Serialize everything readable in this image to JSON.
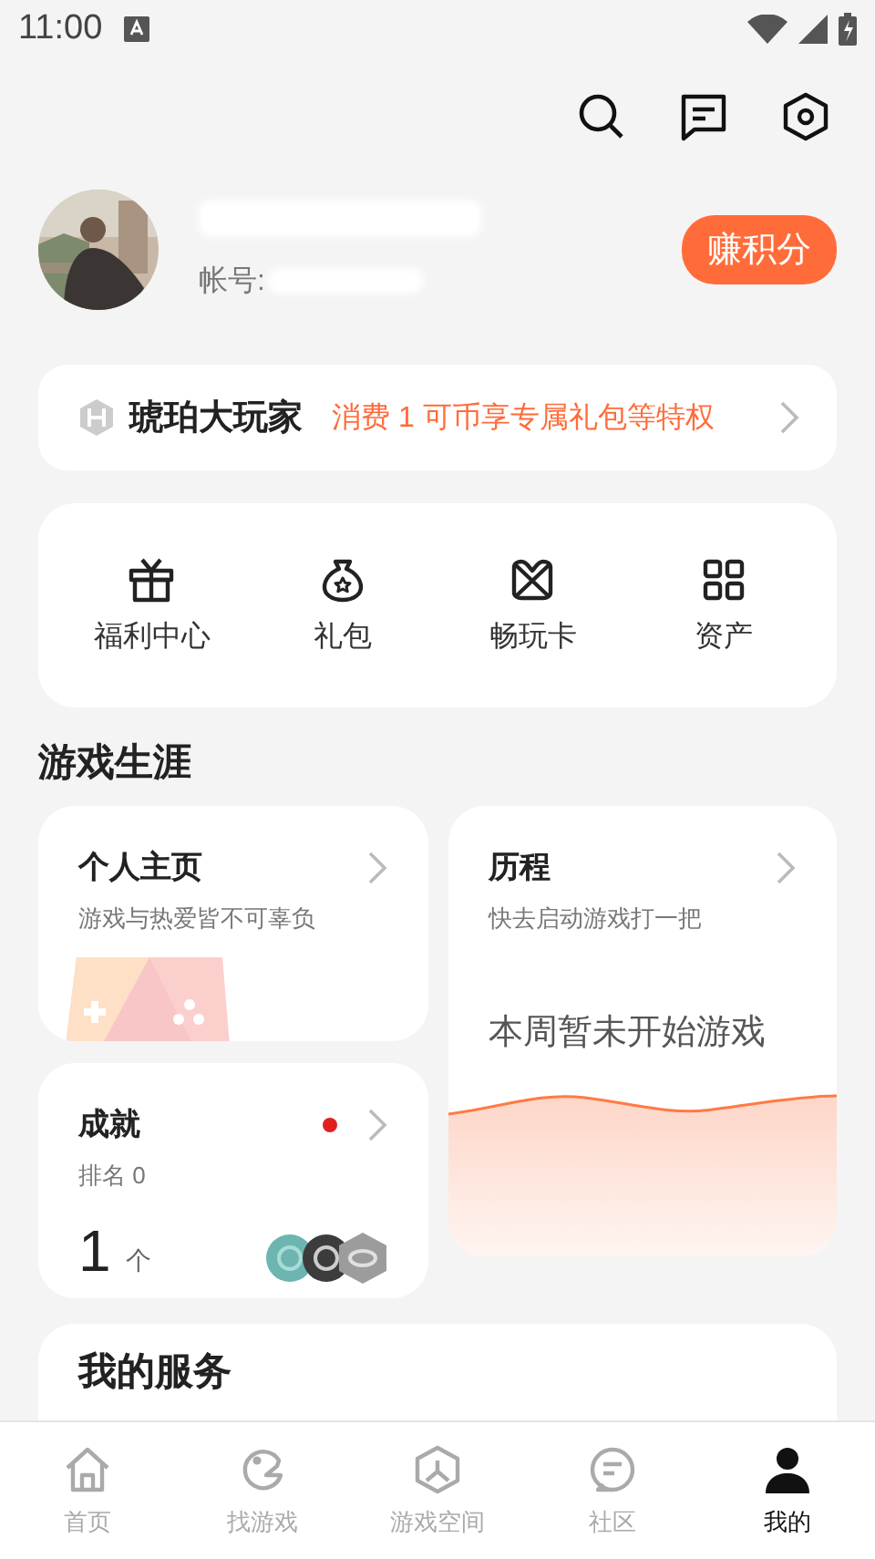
{
  "status_bar": {
    "time": "11:00"
  },
  "profile": {
    "account_label": "帐号:",
    "earn_button": "赚积分"
  },
  "membership": {
    "title": "琥珀大玩家",
    "promo": "消费 1 可币享专属礼包等特权"
  },
  "shortcuts": [
    {
      "label": "福利中心",
      "kind": "gift"
    },
    {
      "label": "礼包",
      "kind": "bag"
    },
    {
      "label": "畅玩卡",
      "kind": "card"
    },
    {
      "label": "资产",
      "kind": "grid"
    }
  ],
  "section_title": "游戏生涯",
  "profile_card": {
    "title": "个人主页",
    "subtitle": "游戏与热爱皆不可辜负"
  },
  "achievements_card": {
    "title": "成就",
    "rank": "排名 0",
    "count": "1",
    "unit": "个",
    "new_dot": true
  },
  "history_card": {
    "title": "历程",
    "subtitle": "快去启动游戏打一把",
    "empty_message": "本周暂未开始游戏"
  },
  "services": {
    "title": "我的服务"
  },
  "tabs": [
    {
      "label": "首页",
      "kind": "home",
      "selected": false
    },
    {
      "label": "找游戏",
      "kind": "find",
      "selected": false
    },
    {
      "label": "游戏空间",
      "kind": "space",
      "selected": false
    },
    {
      "label": "社区",
      "kind": "community",
      "selected": false
    },
    {
      "label": "我的",
      "kind": "me",
      "selected": true
    }
  ]
}
